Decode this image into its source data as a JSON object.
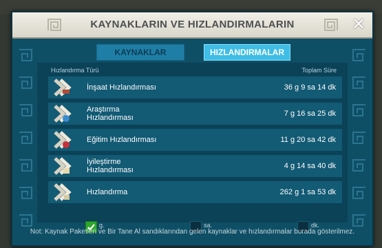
{
  "dialog": {
    "title": "KAYNAKLARIN VE HIZLANDIRMALARIN",
    "close_symbol": "✕"
  },
  "tabs": [
    {
      "label": "KAYNAKLAR",
      "active": false
    },
    {
      "label": "HIZLANDIRMALAR",
      "active": true
    }
  ],
  "table": {
    "col_type_header": "Hızlandırma Türü",
    "col_total_header": "Toplam Süre",
    "rows": [
      {
        "label_lines": [
          "İnşaat Hızlandırması"
        ],
        "value": "36 g 9 sa 14 dk",
        "icon": "hourglass-hammer-icon"
      },
      {
        "label_lines": [
          "Araştırma",
          "Hızlandırması"
        ],
        "value": "7 g 16 sa 25 dk",
        "icon": "hourglass-research-icon"
      },
      {
        "label_lines": [
          "Eğitim Hızlandırması"
        ],
        "value": "11 g 20 sa 42 dk",
        "icon": "hourglass-training-icon"
      },
      {
        "label_lines": [
          "İyileştirme",
          "Hızlandırması"
        ],
        "value": "4 g 14 sa 40 dk",
        "icon": "hourglass-healing-icon"
      },
      {
        "label_lines": [
          "Hızlandırma"
        ],
        "value": "262 g 1 sa 53 dk",
        "icon": "hourglass-speedup-icon"
      }
    ]
  },
  "filters": [
    {
      "label": "g.",
      "checked": true
    },
    {
      "label": "sa.",
      "checked": false
    },
    {
      "label": "dk.",
      "checked": false
    }
  ],
  "footnote": "Not: Kaynak Paketleri ve Bir Tane Al sandıklarından gelen kaynaklar ve hızlandırmalar burada gösterilmez.",
  "colors": {
    "dialog_bg": "#0f4f66",
    "active_tab": "#3fbde6",
    "checkbox_checked": "#2ea82b"
  }
}
